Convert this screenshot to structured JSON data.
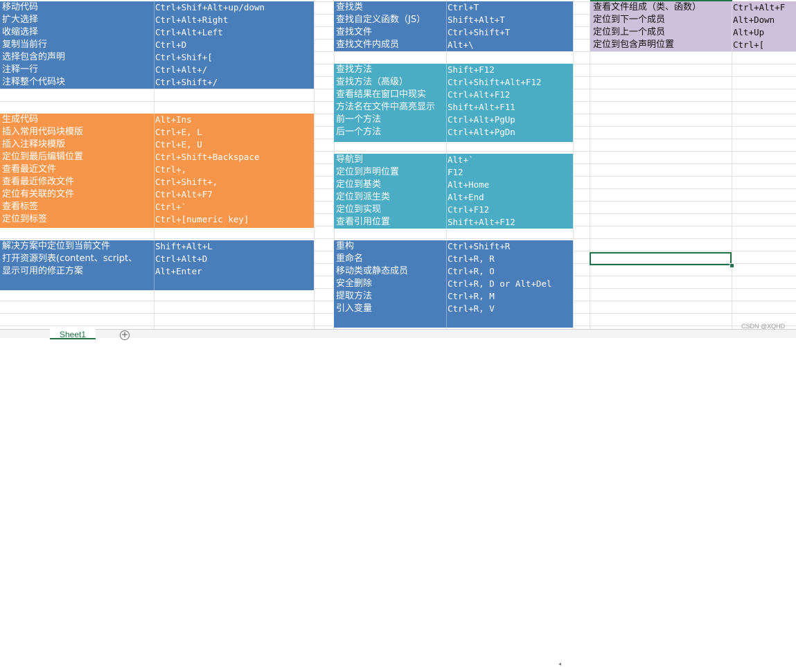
{
  "colors": {
    "blue": "#4a7ebb",
    "orange": "#f7964a",
    "teal": "#4bacc6",
    "lavender": "#ccc0da",
    "selection": "#217346"
  },
  "col1": {
    "group1": [
      {
        "action": "移动代码",
        "keys": "Ctrl+Shif+Alt+up/down"
      },
      {
        "action": "扩大选择",
        "keys": "Ctrl+Alt+Right"
      },
      {
        "action": "收缩选择",
        "keys": "Ctrl+Alt+Left"
      },
      {
        "action": "复制当前行",
        "keys": "Ctrl+D"
      },
      {
        "action": "选择包含的声明",
        "keys": "Ctrl+Shif+["
      },
      {
        "action": "注释一行",
        "keys": "Ctrl+Alt+/"
      },
      {
        "action": "注释整个代码块",
        "keys": "Ctrl+Shift+/"
      }
    ],
    "group2": [
      {
        "action": "生成代码",
        "keys": "Alt+Ins"
      },
      {
        "action": "插入常用代码块模版",
        "keys": "Ctrl+E, L"
      },
      {
        "action": "插入注释块模版",
        "keys": "Ctrl+E, U"
      },
      {
        "action": "定位到最后编辑位置",
        "keys": "Ctrl+Shift+Backspace"
      },
      {
        "action": "查看最近文件",
        "keys": "Ctrl+,"
      },
      {
        "action": "查看最近修改文件",
        "keys": "Ctrl+Shift+,"
      },
      {
        "action": "定位有关联的文件",
        "keys": "Ctrl+Alt+F7"
      },
      {
        "action": "查看标签",
        "keys": "Ctrl+`"
      },
      {
        "action": "定位到标签",
        "keys": "Ctrl+[numeric key]"
      }
    ],
    "group3": [
      {
        "action": "解决方案中定位到当前文件",
        "keys": "Shift+Alt+L"
      },
      {
        "action": "打开资源列表(content、script、",
        "keys": "Ctrl+Alt+D"
      },
      {
        "action": "显示可用的修正方案",
        "keys": "Alt+Enter"
      }
    ]
  },
  "col2": {
    "group1": [
      {
        "action": "查找类",
        "keys": "Ctrl+T"
      },
      {
        "action": "查找自定义函数（JS）",
        "keys": "Shift+Alt+T"
      },
      {
        "action": "查找文件",
        "keys": "Ctrl+Shift+T"
      },
      {
        "action": "查找文件内成员",
        "keys": "Alt+\\"
      }
    ],
    "group2": [
      {
        "action": "查找方法",
        "keys": "Shift+F12"
      },
      {
        "action": "查找方法（高级）",
        "keys": "Ctrl+Shift+Alt+F12"
      },
      {
        "action": "查看结果在窗口中现实",
        "keys": "Ctrl+Alt+F12"
      },
      {
        "action": "方法名在文件中高亮显示",
        "keys": "Shift+Alt+F11"
      },
      {
        "action": "前一个方法",
        "keys": "Ctrl+Alt+PgUp"
      },
      {
        "action": "后一个方法",
        "keys": "Ctrl+Alt+PgDn"
      }
    ],
    "group3": [
      {
        "action": "导航到",
        "keys": "Alt+`"
      },
      {
        "action": "定位到声明位置",
        "keys": "F12"
      },
      {
        "action": "定位到基类",
        "keys": "Alt+Home"
      },
      {
        "action": "定位到派生类",
        "keys": "Alt+End"
      },
      {
        "action": "定位到实现",
        "keys": "Ctrl+F12"
      },
      {
        "action": "查看引用位置",
        "keys": "Shift+Alt+F12"
      }
    ],
    "group4": [
      {
        "action": "重构",
        "keys": "Ctrl+Shift+R"
      },
      {
        "action": "重命名",
        "keys": "Ctrl+R, R"
      },
      {
        "action": "移动类或静态成员",
        "keys": "Ctrl+R, O"
      },
      {
        "action": "安全删除",
        "keys": "Ctrl+R, D or Alt+Del"
      },
      {
        "action": "提取方法",
        "keys": "Ctrl+R, M"
      },
      {
        "action": "引入变量",
        "keys": "Ctrl+R, V"
      }
    ]
  },
  "col3": {
    "group1": [
      {
        "action": "查看文件组成（类、函数）",
        "keys": "Ctrl+Alt+F"
      },
      {
        "action": "定位到下一个成员",
        "keys": "Alt+Down"
      },
      {
        "action": "定位到上一个成员",
        "keys": "Alt+Up"
      },
      {
        "action": "定位到包含声明位置",
        "keys": "Ctrl+["
      }
    ]
  },
  "sheet_tab": "Sheet1",
  "add_sheet": "+",
  "watermark": "CSDN @XQHD"
}
